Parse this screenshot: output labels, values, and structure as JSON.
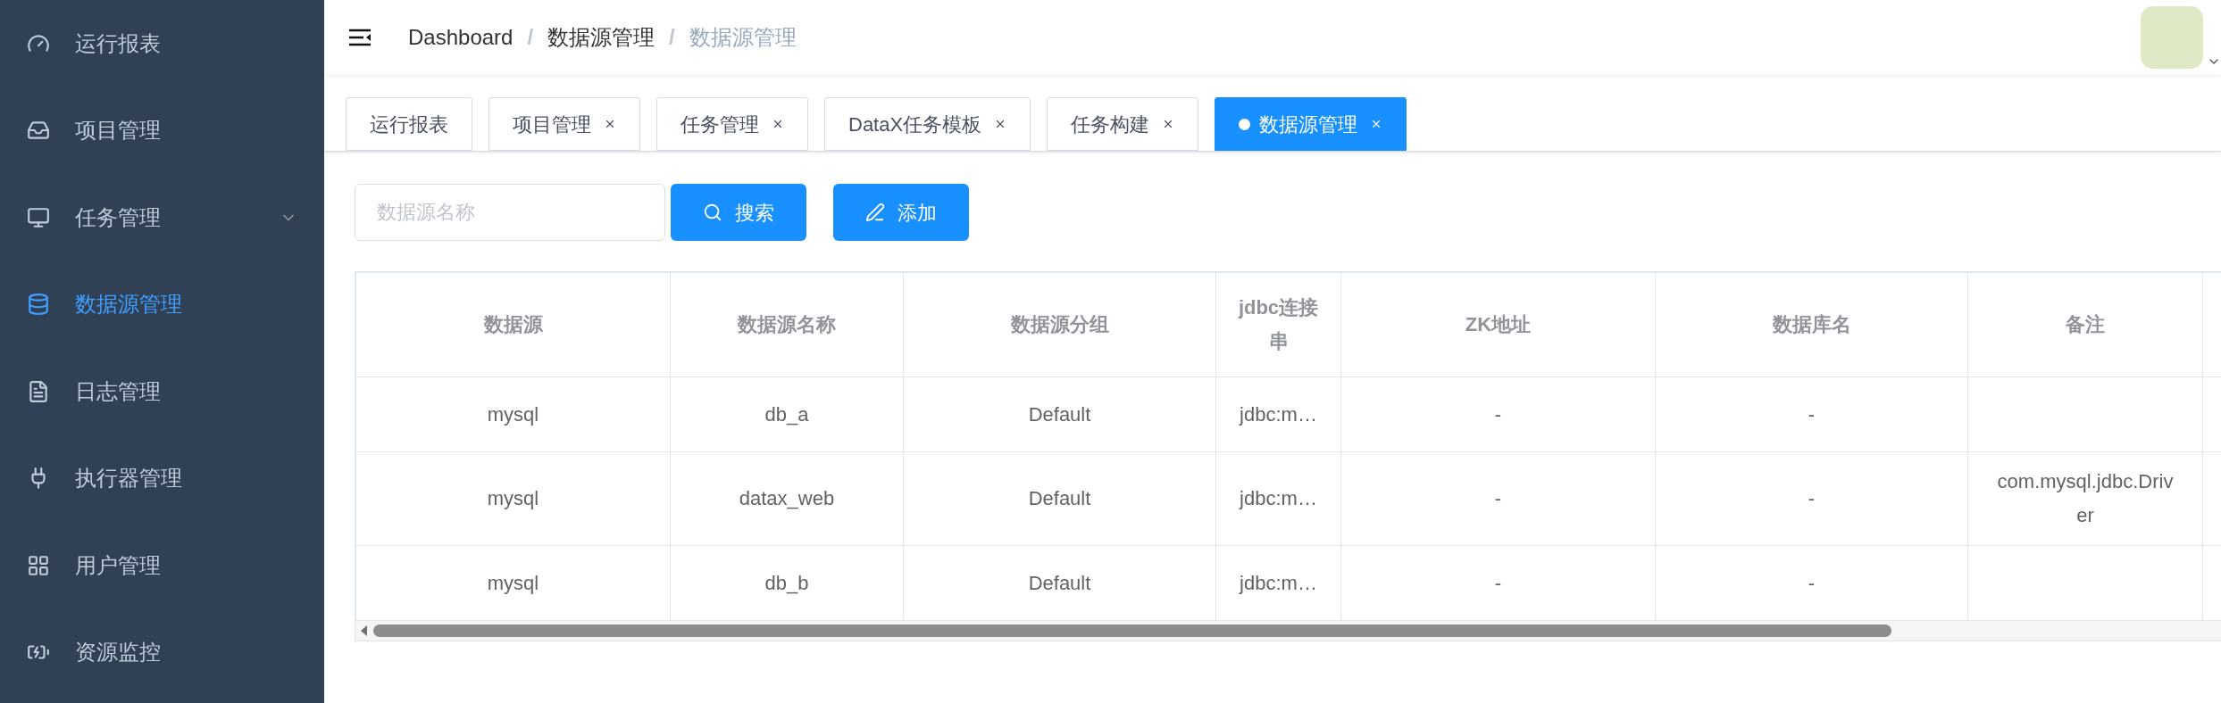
{
  "sidebar": {
    "items": [
      {
        "label": "运行报表",
        "kind": "item",
        "selected": false
      },
      {
        "label": "项目管理",
        "kind": "item",
        "selected": false
      },
      {
        "label": "任务管理",
        "kind": "submenu",
        "selected": false
      },
      {
        "label": "数据源管理",
        "kind": "item",
        "selected": true
      },
      {
        "label": "日志管理",
        "kind": "item",
        "selected": false
      },
      {
        "label": "执行器管理",
        "kind": "item",
        "selected": false
      },
      {
        "label": "用户管理",
        "kind": "item",
        "selected": false
      },
      {
        "label": "资源监控",
        "kind": "item",
        "selected": false
      }
    ]
  },
  "breadcrumb": {
    "separator": "/",
    "items": [
      {
        "label": "Dashboard",
        "current": false
      },
      {
        "label": "数据源管理",
        "current": false
      },
      {
        "label": "数据源管理",
        "current": true
      }
    ]
  },
  "tabs": [
    {
      "label": "运行报表",
      "closable": false,
      "selected": false
    },
    {
      "label": "项目管理",
      "closable": true,
      "selected": false
    },
    {
      "label": "任务管理",
      "closable": true,
      "selected": false
    },
    {
      "label": "DataX任务模板",
      "closable": true,
      "selected": false
    },
    {
      "label": "任务构建",
      "closable": true,
      "selected": false
    },
    {
      "label": "数据源管理",
      "closable": true,
      "selected": true
    }
  ],
  "search": {
    "placeholder": "数据源名称"
  },
  "buttons": [
    {
      "label": "搜索",
      "kind": "search"
    },
    {
      "label": "添加",
      "kind": "add"
    }
  ],
  "table": {
    "columns": [
      "数据源",
      "数据源名称",
      "数据源分组",
      "jdbc连接串",
      "ZK地址",
      "数据库名",
      "备注"
    ],
    "rows": [
      [
        "mysql",
        "db_a",
        "Default",
        "jdbc:m…",
        "-",
        "-"
      ],
      [
        "mysql",
        "datax_web",
        "Default",
        "jdbc:m…",
        "-",
        "-",
        "com.mysql.jdbc.Driver"
      ],
      [
        "mysql",
        "db_b",
        "Default",
        "jdbc:m…",
        "-",
        "-"
      ]
    ]
  }
}
